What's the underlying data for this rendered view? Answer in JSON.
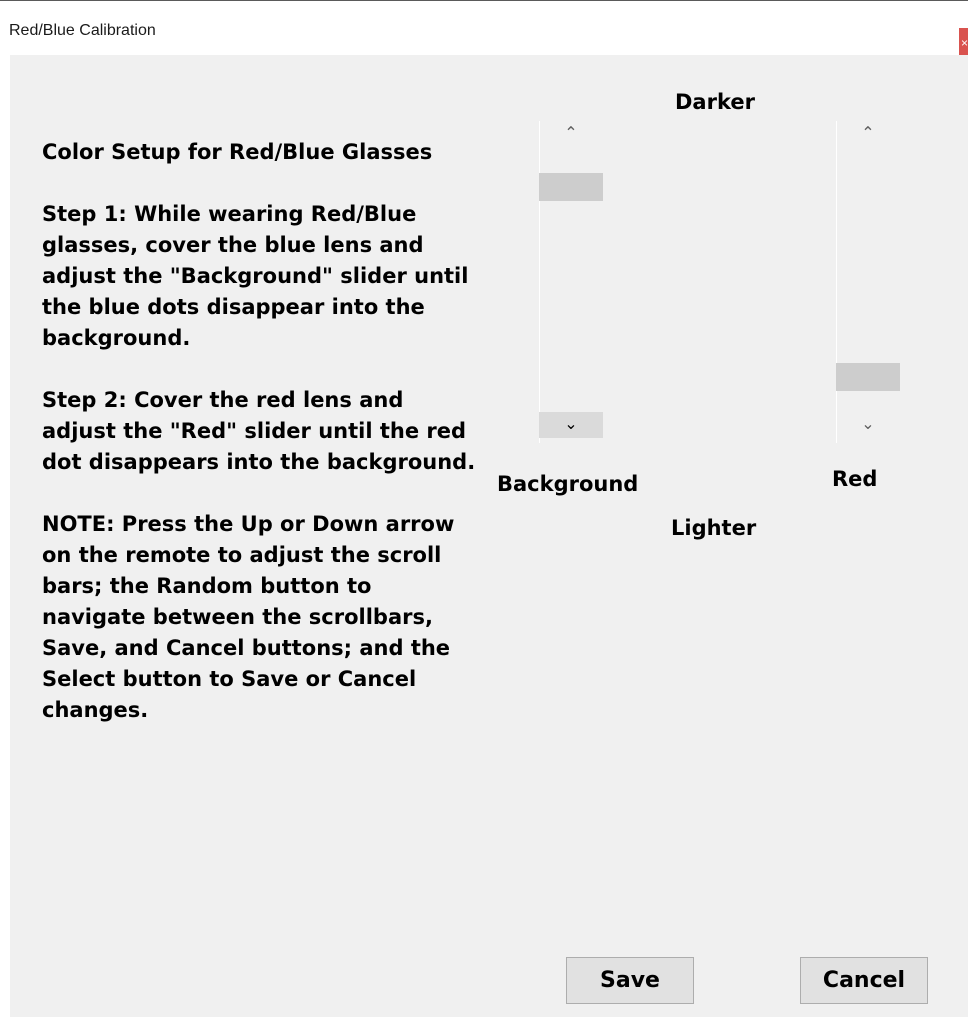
{
  "window": {
    "title": "Red/Blue Calibration",
    "close_glyph": "×"
  },
  "instructions": {
    "heading": "Color Setup for Red/Blue Glasses",
    "step1": "Step 1: While wearing Red/Blue glasses, cover the blue lens and adjust the \"Background\" slider until the blue dots disappear into the background.",
    "step2": "Step 2: Cover the red lens and adjust the \"Red\" slider until the red dot disappears into the background.",
    "note": "NOTE: Press the Up or Down arrow on the remote to adjust the scroll bars; the Random button to navigate between the scrollbars, Save, and Cancel buttons; and the Select button to Save or Cancel changes."
  },
  "sliders": {
    "top_label": "Darker",
    "bottom_label": "Lighter",
    "background": {
      "label": "Background",
      "up_glyph": "⌃",
      "down_glyph": "⌄",
      "position": 0.09
    },
    "red": {
      "label": "Red",
      "up_glyph": "⌃",
      "down_glyph": "⌄",
      "position": 0.91
    }
  },
  "buttons": {
    "save": "Save",
    "cancel": "Cancel"
  },
  "colors": {
    "client_bg": "#f0f0f0",
    "thumb": "#cdcdcd",
    "button_bg": "#e1e1e1",
    "close_bg": "#d9534f"
  }
}
